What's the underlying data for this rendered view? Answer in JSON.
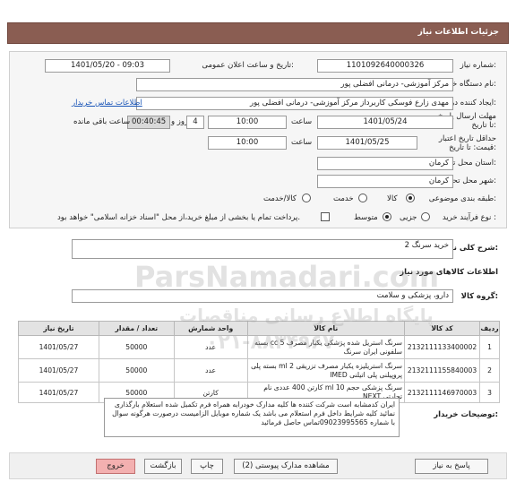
{
  "header": {
    "title": "جزئیات اطلاعات نیاز"
  },
  "form": {
    "need_number": {
      "label": "شماره نیاز:",
      "value": "1101092640000326"
    },
    "announce_datetime": {
      "label": "تاریخ و ساعت اعلان عمومی:",
      "value": "1401/05/20 - 09:03"
    },
    "buyer_org": {
      "label": "نام دستگاه خریدار:",
      "value": "مرکز آموزشی- درمانی افضلی پور"
    },
    "requester": {
      "label": "ایجاد کننده درخواست:",
      "value": "مهدی زارع فوسکی کاربرداز مرکز آموزشی- درمانی افضلی پور",
      "contact_link": "اطلاعات تماس خریدار"
    },
    "reply_deadline": {
      "label": "مهلت ارسال پاسخ تا تاریخ:",
      "date": "1401/05/24",
      "time_label": "ساعت",
      "time": "10:00",
      "days": "4",
      "days_label": "روز و",
      "remaining": "00:40:45",
      "remaining_label": "ساعت باقی مانده"
    },
    "price_validity": {
      "label": "حداقل تاریخ اعتبار قیمت: تا تاریخ:",
      "date": "1401/05/25",
      "time_label": "ساعت",
      "time": "10:00"
    },
    "delivery_province": {
      "label": "استان محل تحویل:",
      "value": "کرمان"
    },
    "delivery_city": {
      "label": "شهر محل تحویل:",
      "value": "کرمان"
    },
    "category": {
      "label": "طبقه بندی موضوعی:",
      "options": [
        "کالا",
        "خدمت",
        "کالا/خدمت"
      ],
      "selected": "کالا"
    },
    "purchase_type": {
      "label": "نوع فرآیند خرید :",
      "options": [
        "جزیی",
        "متوسط"
      ],
      "selected": "متوسط",
      "payment_note": "پرداخت تمام یا بخشی از مبلغ خرید،از محل \"اسناد خزانه اسلامی\" خواهد بود."
    },
    "description": {
      "label": "شرح کلی نیاز:",
      "value": "خرید سرنگ 2"
    }
  },
  "goods": {
    "section_title": "اطلاعات کالاهای مورد نیاز",
    "group_label": "گروه کالا:",
    "group_value": "دارو، پزشکی و سلامت",
    "columns": [
      "ردیف",
      "کد کالا",
      "نام کالا",
      "واحد شمارش",
      "تعداد / مقدار",
      "تاریخ نیاز"
    ],
    "rows": [
      {
        "row": "1",
        "code": "2132111133400002",
        "name": "سرنگ استریل شده پزشکی یکبار مصرف 5 cc بسته سلفونی ایران سرنگ",
        "unit": "عدد",
        "qty": "50000",
        "date": "1401/05/27"
      },
      {
        "row": "2",
        "code": "2132111155840003",
        "name": "سرنگ استریلیزه یکبار مصرف تزریقی 2 ml بسته پلی پروپیلنی پلی اتیلنی IMED",
        "unit": "عدد",
        "qty": "50000",
        "date": "1401/05/27"
      },
      {
        "row": "3",
        "code": "2132111146970003",
        "name": "سرنگ پزشکی حجم 10 ml کارتن 400 عددی نام تجارتی NEXT",
        "unit": "کارتن",
        "qty": "50000",
        "date": "1401/05/27"
      }
    ]
  },
  "buyer_notes": {
    "label": "توضیحات خریدار:",
    "text": "ایران کدمشابه است شرکت کننده ها کلیه مدارک خودرابه همراه فرم تکمیل شده استعلام بارگذاری نمائید کلیه شرایط داخل فرم استعلام می باشد یک شماره موبایل الزامیست درصورت هرگونه سوال با شماره 09023995565تماس حاصل فرمائید"
  },
  "buttons": {
    "reply": "پاسخ به نیاز",
    "attachments": "مشاهده مدارک پیوستی (2)",
    "print": "چاپ",
    "back": "بازگشت",
    "exit": "خروج"
  },
  "watermark": {
    "text": "ParsNamadari.com",
    "sub": "پایگاه اطلاع رسانی مناقصات",
    "phone": "۰۲۱-۸۸۳۴۹۶۷۰"
  },
  "colors": {
    "header": "#8a5d52",
    "exit_button": "#f3b0b0",
    "link": "#1a56b8"
  }
}
